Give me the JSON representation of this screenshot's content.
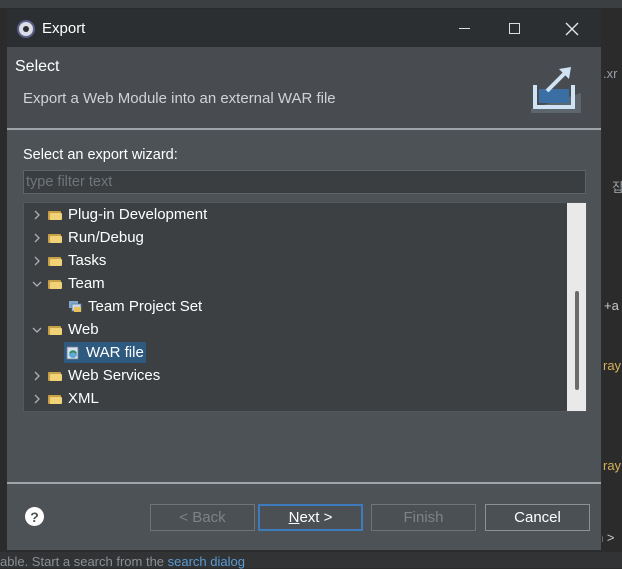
{
  "background": {
    "right_text_1": ".xr",
    "right_text_2": "잡",
    "right_text_3": "+a",
    "right_text_4": "ray",
    "right_text_5": "ray",
    "right_text_6": "h >",
    "bottom_text": "able. Start a search from the ",
    "bottom_link": "search dialog"
  },
  "dialog": {
    "title": "Export",
    "header": {
      "title": "Select",
      "description": "Export a Web Module into an external WAR file"
    },
    "wizard_label": "Select an export wizard:",
    "filter_placeholder": "type filter text",
    "tree": [
      {
        "label": "Plug-in Development",
        "expanded": false,
        "level": 0
      },
      {
        "label": "Run/Debug",
        "expanded": false,
        "level": 0
      },
      {
        "label": "Tasks",
        "expanded": false,
        "level": 0
      },
      {
        "label": "Team",
        "expanded": true,
        "level": 0
      },
      {
        "label": "Team Project Set",
        "level": 1
      },
      {
        "label": "Web",
        "expanded": true,
        "level": 0
      },
      {
        "label": "WAR file",
        "level": 1,
        "selected": true
      },
      {
        "label": "Web Services",
        "expanded": false,
        "level": 0
      },
      {
        "label": "XML",
        "expanded": false,
        "level": 0
      }
    ],
    "buttons": {
      "help": "?",
      "back": "< Back",
      "next_prefix": "N",
      "next_rest": "ext >",
      "finish": "Finish",
      "cancel": "Cancel"
    }
  },
  "colors": {
    "dialog_bg": "#4d5256",
    "titlebar_bg": "#2c2f31",
    "selection": "#2f5a80",
    "default_button_border": "#3d7bbd"
  }
}
